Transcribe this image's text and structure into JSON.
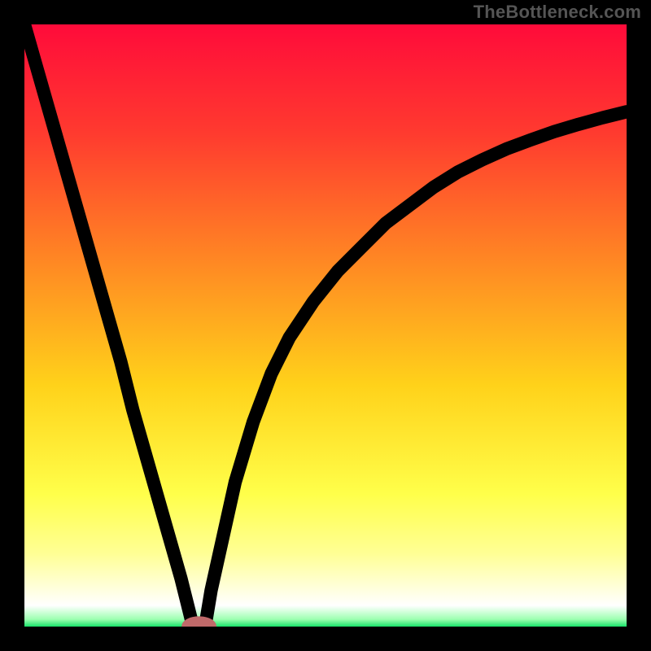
{
  "attribution": "TheBottleneck.com",
  "chart_data": {
    "type": "line",
    "title": "",
    "xlabel": "",
    "ylabel": "",
    "xlim": [
      0,
      100
    ],
    "ylim": [
      0,
      100
    ],
    "grid": false,
    "legend": false,
    "axes_visible": false,
    "gradient_stops": [
      {
        "offset": 0.0,
        "color": "#ff0b3a"
      },
      {
        "offset": 0.18,
        "color": "#ff3a2f"
      },
      {
        "offset": 0.4,
        "color": "#ff8a23"
      },
      {
        "offset": 0.6,
        "color": "#ffd21a"
      },
      {
        "offset": 0.78,
        "color": "#ffff4a"
      },
      {
        "offset": 0.88,
        "color": "#ffff96"
      },
      {
        "offset": 0.94,
        "color": "#ffffe0"
      },
      {
        "offset": 0.965,
        "color": "#ffffff"
      },
      {
        "offset": 0.988,
        "color": "#9cffb0"
      },
      {
        "offset": 1.0,
        "color": "#19e36a"
      }
    ],
    "series": [
      {
        "name": "left-branch",
        "x": [
          0,
          2,
          4,
          6,
          8,
          10,
          12,
          14,
          16,
          18,
          20,
          22,
          24,
          26,
          27,
          28
        ],
        "y": [
          100,
          93,
          86,
          79,
          72,
          65,
          58,
          51,
          44,
          36,
          29,
          22,
          15,
          8,
          4,
          0
        ]
      },
      {
        "name": "right-branch",
        "x": [
          30,
          31,
          33,
          35,
          38,
          41,
          44,
          48,
          52,
          56,
          60,
          64,
          68,
          72,
          76,
          80,
          84,
          88,
          92,
          96,
          100
        ],
        "y": [
          0,
          6,
          15,
          24,
          34,
          42,
          48,
          54,
          59,
          63,
          67,
          70,
          73,
          75.5,
          77.5,
          79.3,
          80.8,
          82.2,
          83.4,
          84.5,
          85.5
        ]
      }
    ],
    "marker": {
      "x": 29,
      "y": 0,
      "rx": 2.4,
      "ry": 1.2,
      "color": "#c06a6a"
    }
  }
}
